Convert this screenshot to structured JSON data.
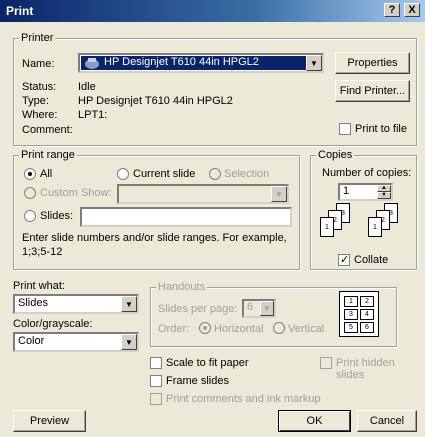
{
  "window": {
    "title": "Print",
    "help_label": "?",
    "close_label": "X"
  },
  "printer": {
    "group_label": "Printer",
    "name_label": "Name:",
    "name_value": "HP Designjet T610 44in HPGL2",
    "status_label": "Status:",
    "status_value": "Idle",
    "type_label": "Type:",
    "type_value": "HP Designjet T610 44in HPGL2",
    "where_label": "Where:",
    "where_value": "LPT1:",
    "comment_label": "Comment:",
    "comment_value": "",
    "properties_label": "Properties",
    "find_printer_label": "Find Printer...",
    "print_to_file_label": "Print to file",
    "print_to_file_checked": false
  },
  "print_range": {
    "group_label": "Print range",
    "all_label": "All",
    "current_slide_label": "Current slide",
    "selection_label": "Selection",
    "custom_show_label": "Custom Show:",
    "custom_show_value": "",
    "slides_label": "Slides:",
    "slides_value": "",
    "hint": "Enter slide numbers and/or slide ranges. For example, 1;3;5-12",
    "selected": "All"
  },
  "copies": {
    "group_label": "Copies",
    "number_label": "Number of copies:",
    "number_value": "1",
    "collate_label": "Collate",
    "collate_checked": true,
    "stack1": [
      "1",
      "2",
      "3"
    ],
    "stack2": [
      "1",
      "2",
      "3"
    ]
  },
  "print_what": {
    "label": "Print what:",
    "value": "Slides"
  },
  "color": {
    "label": "Color/grayscale:",
    "value": "Color"
  },
  "handouts": {
    "group_label": "Handouts",
    "slides_per_page_label": "Slides per page:",
    "slides_per_page_value": "6",
    "order_label": "Order:",
    "horizontal_label": "Horizontal",
    "vertical_label": "Vertical",
    "order_selected": "Horizontal",
    "preview_pages": [
      "1",
      "2",
      "3",
      "4",
      "5",
      "6"
    ]
  },
  "options": {
    "scale_to_fit_label": "Scale to fit paper",
    "frame_slides_label": "Frame slides",
    "print_comments_label": "Print comments and ink markup",
    "print_hidden_label": "Print hidden slides"
  },
  "buttons": {
    "preview": "Preview",
    "ok": "OK",
    "cancel": "Cancel"
  }
}
